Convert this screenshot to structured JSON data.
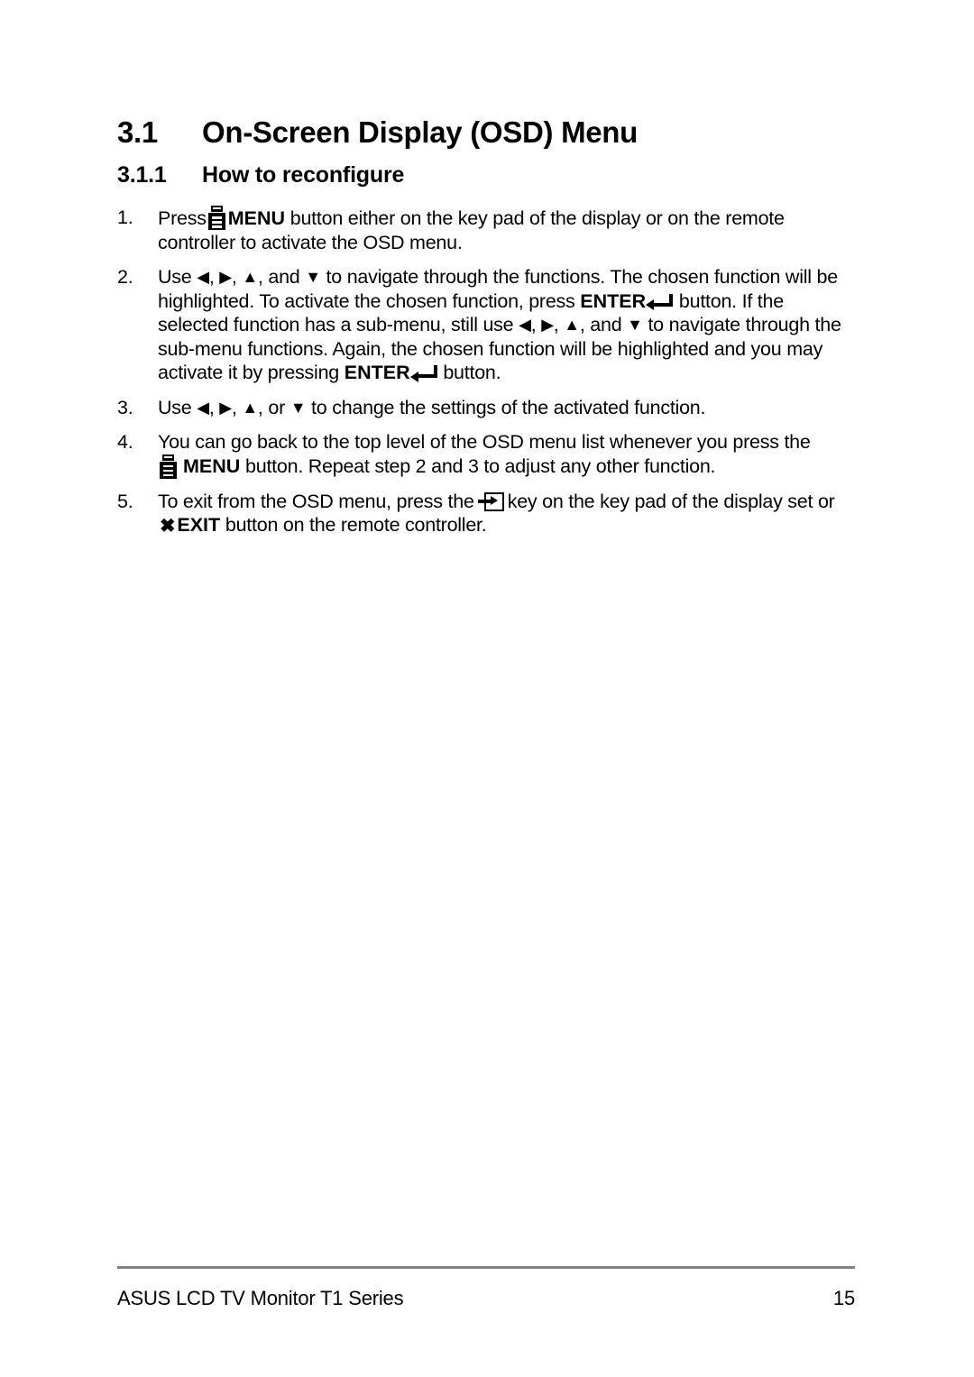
{
  "document": {
    "heading": {
      "section_number": "3.1",
      "section_title": "On-Screen Display (OSD) Menu",
      "subsection_number": "3.1.1",
      "subsection_title": "How to reconfigure"
    },
    "steps": [
      {
        "marker": "1.",
        "parts": {
          "p1": "Press",
          "icon1": "menu-key-icon",
          "p2": "MENU",
          "p3": "button either on the key pad of the display or on the remote controller to activate the OSD menu."
        }
      },
      {
        "marker": "2.",
        "parts": {
          "p1": "Use",
          "a1": "◀",
          "s1": ",",
          "a2": "▶",
          "s2": ",",
          "a3": "▲",
          "s3": ", and",
          "a4": "▼",
          "p2": "to navigate through the functions. The chosen function will be highlighted. To activate the chosen function, press",
          "kw1": "ENTER",
          "icon1": "enter-return-icon",
          "p3": "button. If the selected function has a sub-menu, still use",
          "a5": "◀",
          "s4": ",",
          "a6": "▶",
          "s5": ",",
          "a7": "▲",
          "s6": ", and",
          "a8": "▼",
          "p4": "to navigate through the sub-menu functions. Again, the chosen function will be highlighted and you may activate it by pressing",
          "kw2": "ENTER",
          "icon2": "enter-return-icon",
          "p5": "button."
        }
      },
      {
        "marker": "3.",
        "parts": {
          "p1": "Use",
          "a1": "◀",
          "s1": ",",
          "a2": "▶",
          "s2": ",",
          "a3": "▲",
          "s3": ", or",
          "a4": "▼",
          "p2": "to change the settings of the activated function."
        }
      },
      {
        "marker": "4.",
        "parts": {
          "p1": "You can go back to the top level of the OSD menu list whenever you press the",
          "icon1": "menu-key-icon",
          "p2": "MENU",
          "p3": "button. Repeat step 2 and 3 to adjust any other function."
        }
      },
      {
        "marker": "5.",
        "parts": {
          "p1": "To exit from the OSD menu, press the",
          "icon1": "input-source-key-icon",
          "p2": "key on the key pad of the display set or",
          "icon2": "heavy-x-icon",
          "x_glyph": "✖",
          "p3": "EXIT",
          "p4": "button on the remote controller."
        }
      }
    ],
    "footer": {
      "left_text": "ASUS LCD TV Monitor T1 Series",
      "page_number": "15",
      "rule_color": "#808080"
    }
  }
}
